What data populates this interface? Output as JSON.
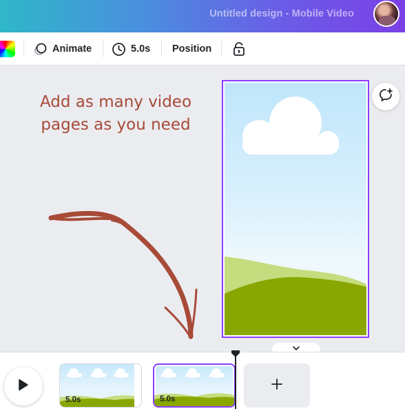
{
  "header": {
    "title": "Untitled design - Mobile Video"
  },
  "toolbar": {
    "animate_label": "Animate",
    "duration_label": "5.0s",
    "position_label": "Position"
  },
  "canvas": {
    "annotation_line1": "Add as many video",
    "annotation_line2": "pages as you need",
    "annotation_color": "#a84a38",
    "selection_color": "#8b3dff"
  },
  "timeline": {
    "pages": [
      {
        "duration": "5.0s",
        "selected": false
      },
      {
        "duration": "5.0s",
        "selected": true
      }
    ],
    "add_page_symbol": "+"
  },
  "icons": {
    "color": "color-swatch",
    "animate": "animate-icon",
    "duration": "clock-icon",
    "lock": "lock-icon",
    "comment": "add-comment-icon",
    "play": "play-icon",
    "collapse": "chevron-down-icon"
  }
}
